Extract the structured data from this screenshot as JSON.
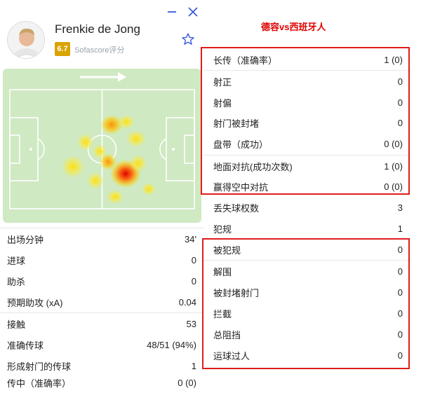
{
  "player": {
    "name": "Frenkie de Jong",
    "rating": "6.7",
    "rating_label": "Sofascore评分"
  },
  "colors": {
    "rating_badge": "#d9a300",
    "pitch": "#cfe9c2",
    "accent_blue": "#3b5bdb",
    "highlight_red": "#e01c1c"
  },
  "icons": [
    "minimize-icon",
    "close-icon",
    "star-icon",
    "attack-direction-arrow-icon"
  ],
  "compare_title": "德容vs西班牙人",
  "left_stats": [
    {
      "label": "出场分钟",
      "value": "34'"
    },
    {
      "label": "进球",
      "value": "0"
    },
    {
      "label": "助杀",
      "value": "0"
    },
    {
      "label": "预期助攻 (xA)",
      "value": "0.04"
    },
    {
      "label": "接触",
      "value": "53"
    },
    {
      "label": "准确传球",
      "value": "48/51 (94%)"
    },
    {
      "label": "形成射门的传球",
      "value": "1"
    },
    {
      "label": "传中（准确率）",
      "value": "0 (0)"
    }
  ],
  "right_stats": [
    {
      "label": "长传（准确率）",
      "value": "1 (0)"
    },
    {
      "label": "射正",
      "value": "0"
    },
    {
      "label": "射偏",
      "value": "0"
    },
    {
      "label": "射门被封堵",
      "value": "0"
    },
    {
      "label": "盘带（成功）",
      "value": "0 (0)"
    },
    {
      "label": "地面对抗(成功次数)",
      "value": "1 (0)"
    },
    {
      "label": "赢得空中对抗",
      "value": "0 (0)"
    },
    {
      "label": "丢失球权数",
      "value": "3"
    },
    {
      "label": "犯规",
      "value": "1"
    },
    {
      "label": "被犯规",
      "value": "0"
    },
    {
      "label": "解围",
      "value": "0"
    },
    {
      "label": "被封堵射门",
      "value": "0"
    },
    {
      "label": "拦截",
      "value": "0"
    },
    {
      "label": "总阻挡",
      "value": "0"
    },
    {
      "label": "运球过人",
      "value": "0"
    }
  ]
}
